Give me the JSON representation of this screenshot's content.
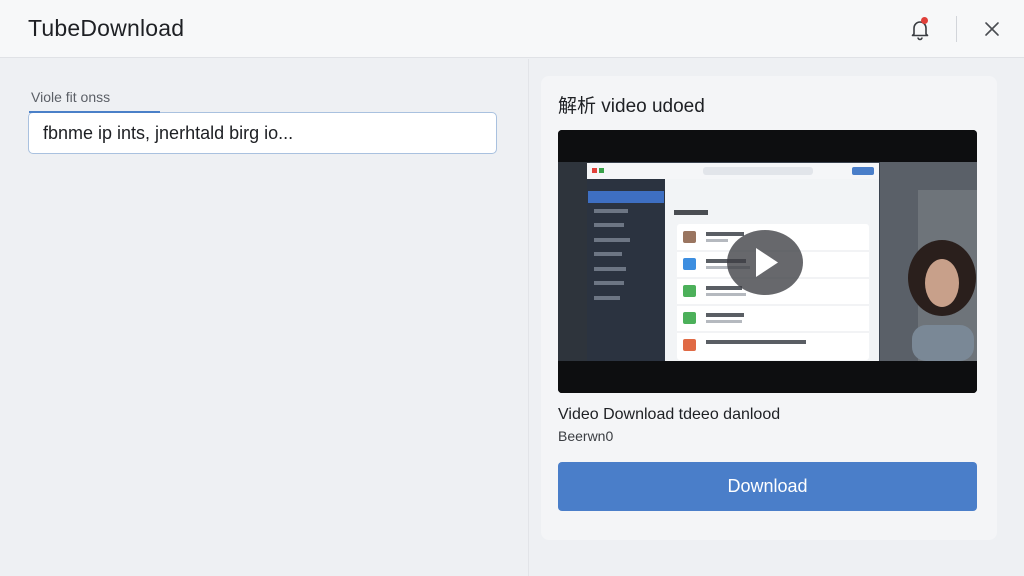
{
  "app": {
    "title": "TubeDownload"
  },
  "header": {
    "notifications_icon": "bell-icon",
    "close_icon": "close-icon",
    "notification_color": "#e0403a"
  },
  "form": {
    "label": "Viole fit onss",
    "url_value": "fbnme ip ints, jnerhtald birg io..."
  },
  "preview": {
    "title": "解析 video udoed",
    "video_title": "Video Download tdeeo danlood",
    "video_subtitle": "Beerwn0"
  },
  "actions": {
    "download_label": "Download"
  },
  "colors": {
    "accent": "#4a7ec9",
    "input_border": "#a9c1df"
  }
}
